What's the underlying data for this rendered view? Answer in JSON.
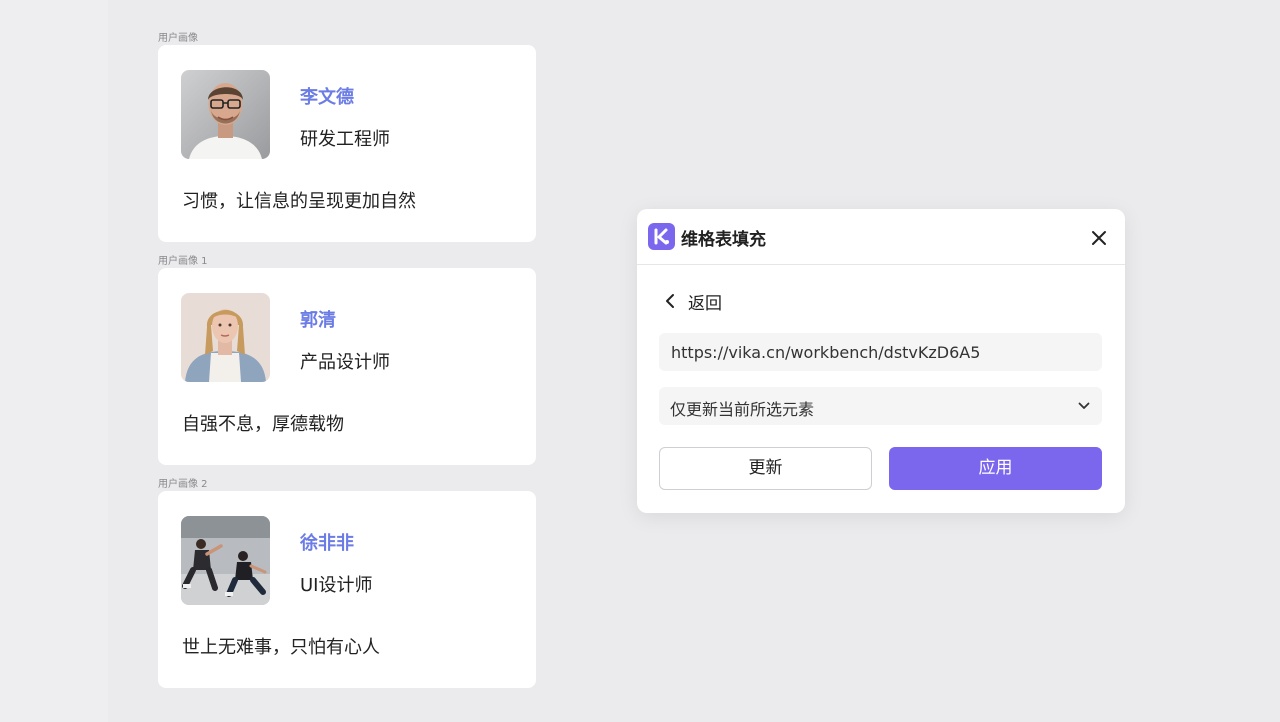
{
  "cards": [
    {
      "frame_label": "用户画像",
      "name": "李文德",
      "role": "研发工程师",
      "motto": "习惯，让信息的呈现更加自然",
      "avatar": "man-with-glasses-photo"
    },
    {
      "frame_label": "用户画像 1",
      "name": "郭清",
      "role": "产品设计师",
      "motto": "自强不息，厚德载物",
      "avatar": "woman-denim-jacket-photo"
    },
    {
      "frame_label": "用户画像 2",
      "name": "徐非非",
      "role": "UI设计师",
      "motto": "世上无难事，只怕有心人",
      "avatar": "breakdancers-photo"
    }
  ],
  "dialog": {
    "title": "维格表填充",
    "logo_icon": "vika-logo-icon",
    "close_icon": "close-icon",
    "back_label": "返回",
    "url_value": "https://vika.cn/workbench/dstvKzD6A5",
    "scope_select": {
      "selected": "仅更新当前所选元素",
      "icon": "chevron-down-icon"
    },
    "update_button": "更新",
    "apply_button": "应用"
  },
  "colors": {
    "background": "#ebebed",
    "card": "#ffffff",
    "name_accent": "#6b7ce6",
    "primary": "#7b67ee",
    "field_bg": "#f5f5f6"
  }
}
